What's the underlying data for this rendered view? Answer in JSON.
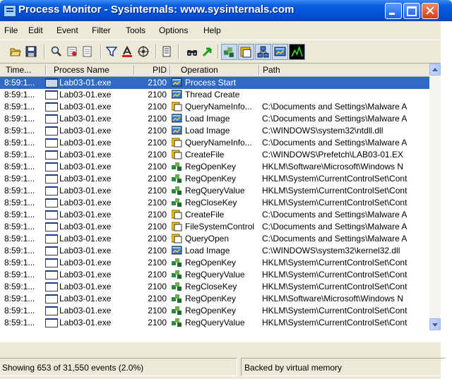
{
  "window": {
    "title": "Process Monitor - Sysinternals: www.sysinternals.com"
  },
  "menu": [
    "File",
    "Edit",
    "Event",
    "Filter",
    "Tools",
    "Options",
    "Help"
  ],
  "toolbar": {
    "icons": [
      "open-icon",
      "save-icon",
      "magnify-icon",
      "capture-icon",
      "autoscroll-icon",
      "filter-icon",
      "highlight-icon",
      "target-icon",
      "properties-icon",
      "find-icon",
      "jump-icon",
      "registry-icon",
      "filesystem-icon",
      "network-icon",
      "process-icon",
      "profiling-icon"
    ]
  },
  "columns": {
    "time": "Time...",
    "process": "Process Name",
    "pid": "PID",
    "operation": "Operation",
    "path": "Path"
  },
  "rows": [
    {
      "time": "8:59:1...",
      "process": "Lab03-01.exe",
      "pid": "2100",
      "operation": "Process Start",
      "path": "",
      "op_type": "process",
      "selected": true
    },
    {
      "time": "8:59:1...",
      "process": "Lab03-01.exe",
      "pid": "2100",
      "operation": "Thread Create",
      "path": "",
      "op_type": "process",
      "selected": false
    },
    {
      "time": "8:59:1...",
      "process": "Lab03-01.exe",
      "pid": "2100",
      "operation": "QueryNameInfo...",
      "path": "C:\\Documents and Settings\\Malware A",
      "op_type": "file",
      "selected": false
    },
    {
      "time": "8:59:1...",
      "process": "Lab03-01.exe",
      "pid": "2100",
      "operation": "Load Image",
      "path": "C:\\Documents and Settings\\Malware A",
      "op_type": "process",
      "selected": false
    },
    {
      "time": "8:59:1...",
      "process": "Lab03-01.exe",
      "pid": "2100",
      "operation": "Load Image",
      "path": "C:\\WINDOWS\\system32\\ntdll.dll",
      "op_type": "process",
      "selected": false
    },
    {
      "time": "8:59:1...",
      "process": "Lab03-01.exe",
      "pid": "2100",
      "operation": "QueryNameInfo...",
      "path": "C:\\Documents and Settings\\Malware A",
      "op_type": "file",
      "selected": false
    },
    {
      "time": "8:59:1...",
      "process": "Lab03-01.exe",
      "pid": "2100",
      "operation": "CreateFile",
      "path": "C:\\WINDOWS\\Prefetch\\LAB03-01.EX",
      "op_type": "file",
      "selected": false
    },
    {
      "time": "8:59:1...",
      "process": "Lab03-01.exe",
      "pid": "2100",
      "operation": "RegOpenKey",
      "path": "HKLM\\Software\\Microsoft\\Windows N",
      "op_type": "registry",
      "selected": false
    },
    {
      "time": "8:59:1...",
      "process": "Lab03-01.exe",
      "pid": "2100",
      "operation": "RegOpenKey",
      "path": "HKLM\\System\\CurrentControlSet\\Cont",
      "op_type": "registry",
      "selected": false
    },
    {
      "time": "8:59:1...",
      "process": "Lab03-01.exe",
      "pid": "2100",
      "operation": "RegQueryValue",
      "path": "HKLM\\System\\CurrentControlSet\\Cont",
      "op_type": "registry",
      "selected": false
    },
    {
      "time": "8:59:1...",
      "process": "Lab03-01.exe",
      "pid": "2100",
      "operation": "RegCloseKey",
      "path": "HKLM\\System\\CurrentControlSet\\Cont",
      "op_type": "registry",
      "selected": false
    },
    {
      "time": "8:59:1...",
      "process": "Lab03-01.exe",
      "pid": "2100",
      "operation": "CreateFile",
      "path": "C:\\Documents and Settings\\Malware A",
      "op_type": "file",
      "selected": false
    },
    {
      "time": "8:59:1...",
      "process": "Lab03-01.exe",
      "pid": "2100",
      "operation": "FileSystemControl",
      "path": "C:\\Documents and Settings\\Malware A",
      "op_type": "file",
      "selected": false
    },
    {
      "time": "8:59:1...",
      "process": "Lab03-01.exe",
      "pid": "2100",
      "operation": "QueryOpen",
      "path": "C:\\Documents and Settings\\Malware A",
      "op_type": "file",
      "selected": false
    },
    {
      "time": "8:59:1...",
      "process": "Lab03-01.exe",
      "pid": "2100",
      "operation": "Load Image",
      "path": "C:\\WINDOWS\\system32\\kernel32.dll",
      "op_type": "process",
      "selected": false
    },
    {
      "time": "8:59:1...",
      "process": "Lab03-01.exe",
      "pid": "2100",
      "operation": "RegOpenKey",
      "path": "HKLM\\System\\CurrentControlSet\\Cont",
      "op_type": "registry",
      "selected": false
    },
    {
      "time": "8:59:1...",
      "process": "Lab03-01.exe",
      "pid": "2100",
      "operation": "RegQueryValue",
      "path": "HKLM\\System\\CurrentControlSet\\Cont",
      "op_type": "registry",
      "selected": false
    },
    {
      "time": "8:59:1...",
      "process": "Lab03-01.exe",
      "pid": "2100",
      "operation": "RegCloseKey",
      "path": "HKLM\\System\\CurrentControlSet\\Cont",
      "op_type": "registry",
      "selected": false
    },
    {
      "time": "8:59:1...",
      "process": "Lab03-01.exe",
      "pid": "2100",
      "operation": "RegOpenKey",
      "path": "HKLM\\Software\\Microsoft\\Windows N",
      "op_type": "registry",
      "selected": false
    },
    {
      "time": "8:59:1...",
      "process": "Lab03-01.exe",
      "pid": "2100",
      "operation": "RegOpenKey",
      "path": "HKLM\\System\\CurrentControlSet\\Cont",
      "op_type": "registry",
      "selected": false
    },
    {
      "time": "8:59:1...",
      "process": "Lab03-01.exe",
      "pid": "2100",
      "operation": "RegQueryValue",
      "path": "HKLM\\System\\CurrentControlSet\\Cont",
      "op_type": "registry",
      "selected": false
    }
  ],
  "status": {
    "events": "Showing 653 of 31,550 events (2.0%)",
    "backing": "Backed by virtual memory"
  },
  "colors": {
    "selection": "#316ac5",
    "titlebar": "#0453d8",
    "registry": "#2e8b3e",
    "file": "#e7b800",
    "process": "#3b78d8"
  }
}
